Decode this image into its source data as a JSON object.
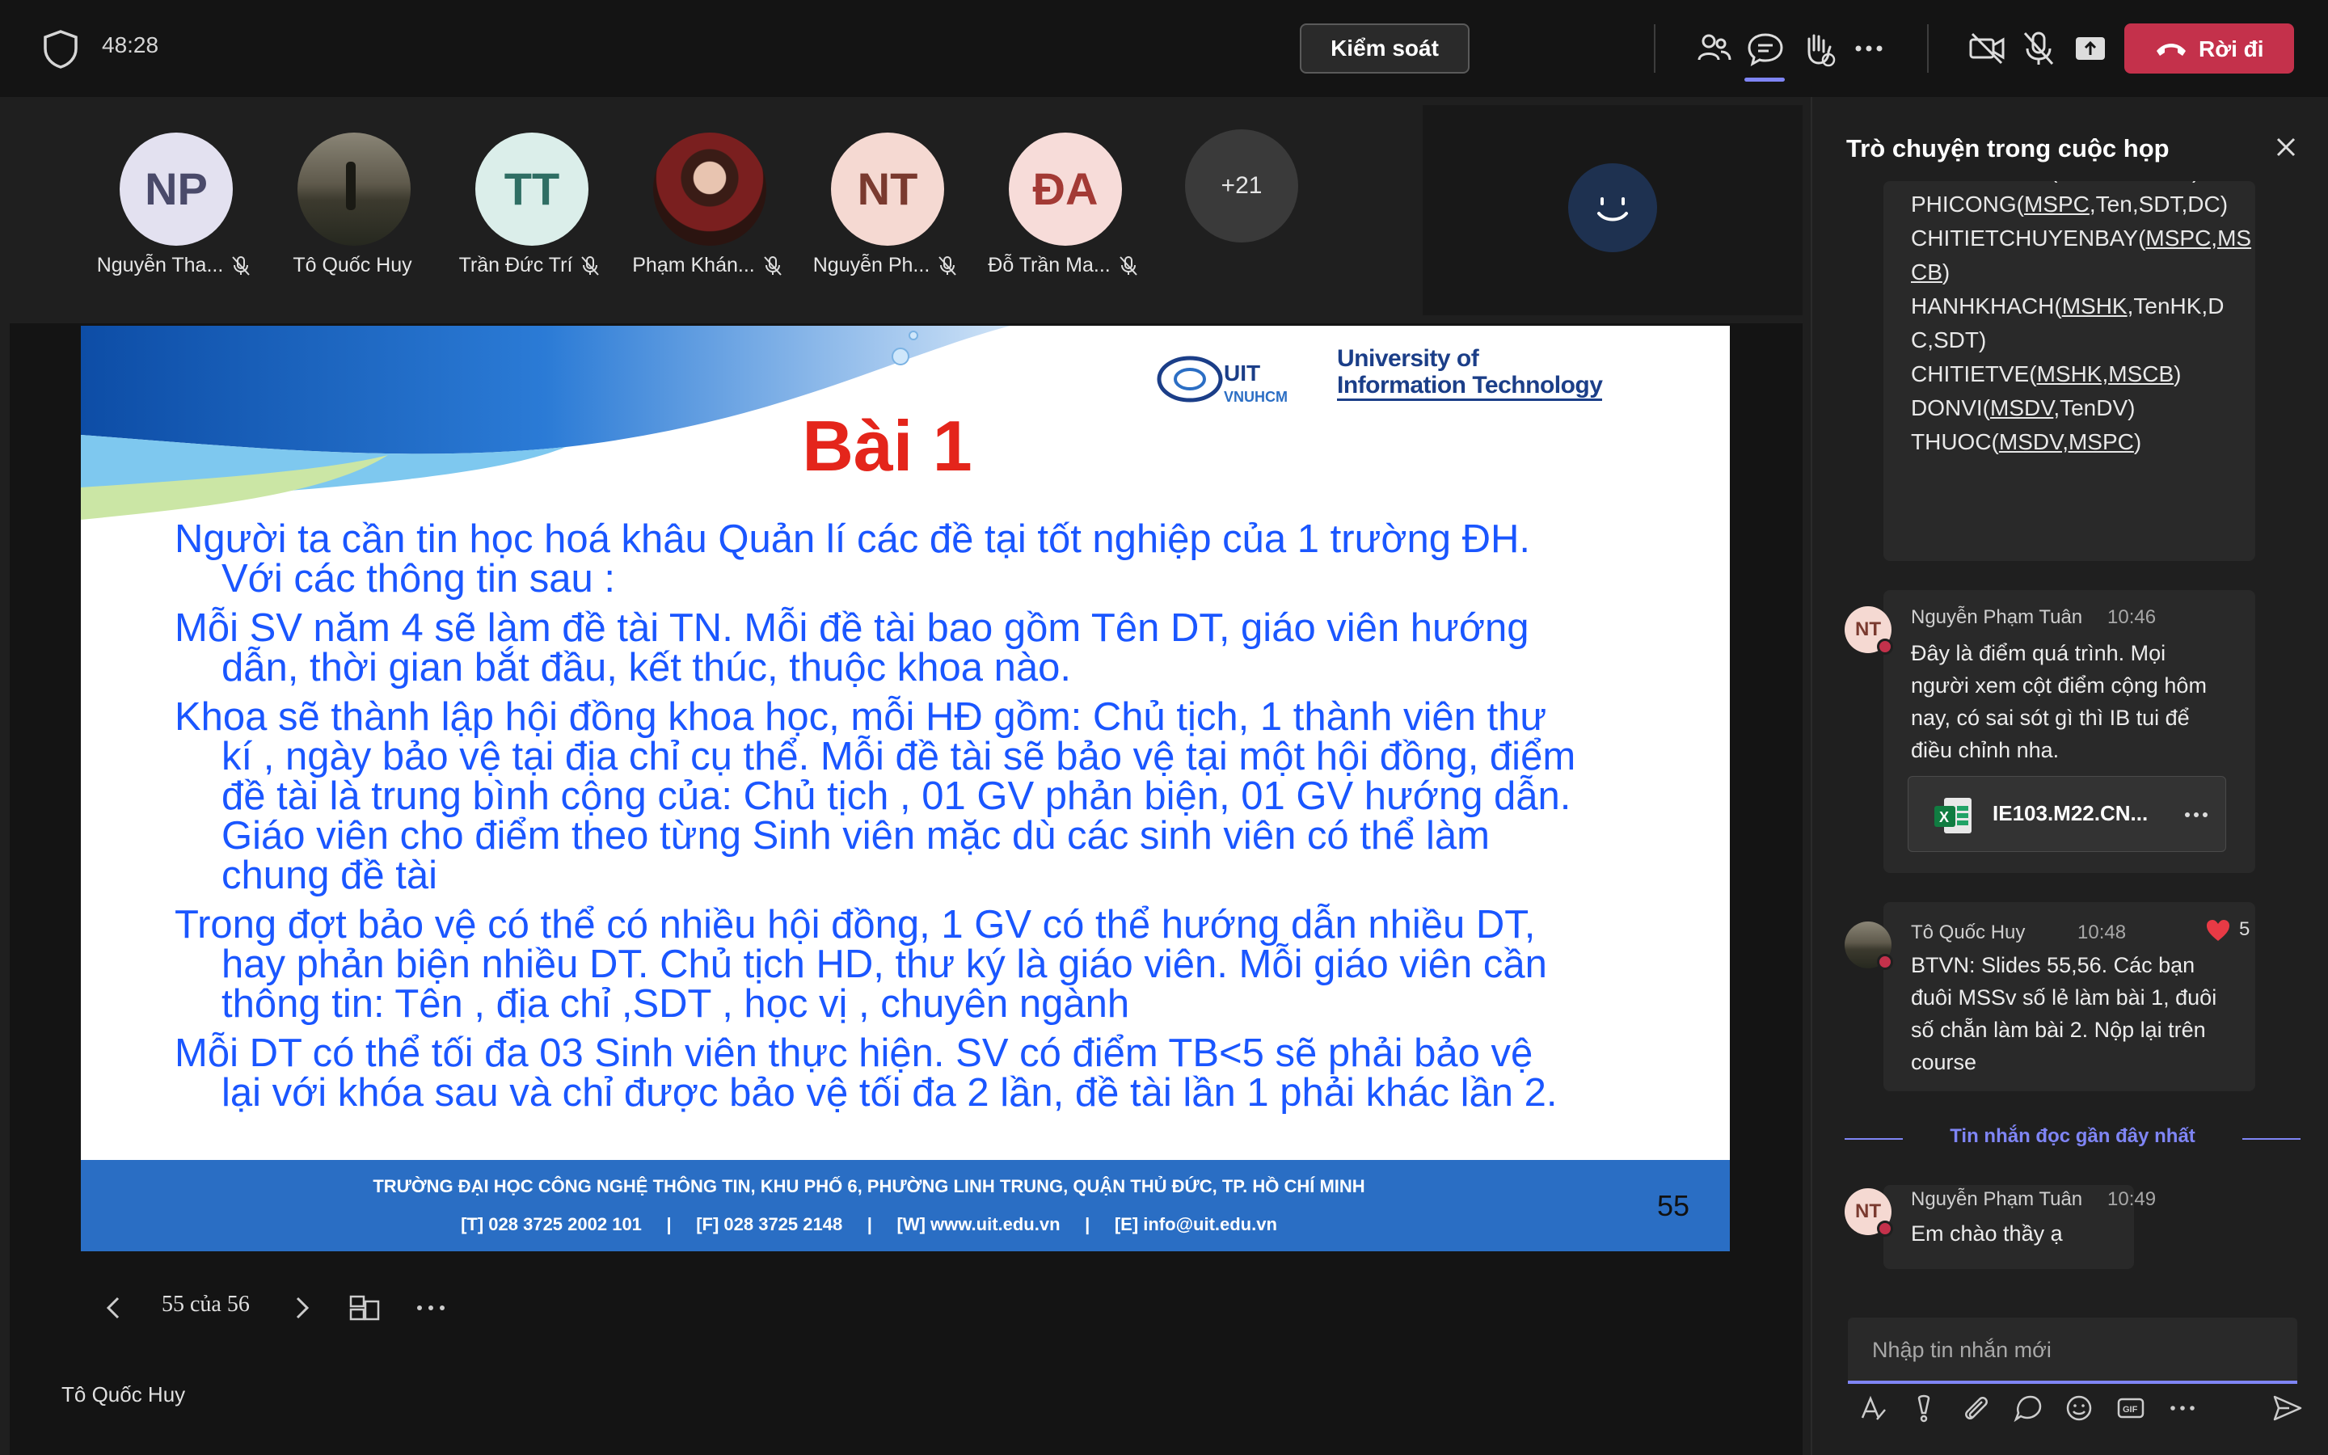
{
  "topbar": {
    "timer": "48:28",
    "control_label": "Kiểm soát",
    "leave_label": "Rời đi"
  },
  "participants": [
    {
      "initials": "NP",
      "name": "Nguyễn Tha...",
      "bg": "#e3e1f0",
      "fg": "#4a4a6a",
      "muted": true
    },
    {
      "initials": "",
      "name": "Tô Quốc Huy",
      "photo": true,
      "muted": false
    },
    {
      "initials": "TT",
      "name": "Trần Đức Trí",
      "bg": "#dbeeea",
      "fg": "#2f6e64",
      "muted": true
    },
    {
      "initials": "",
      "name": "Phạm Khán...",
      "photo": true,
      "muted": true
    },
    {
      "initials": "NT",
      "name": "Nguyễn Ph...",
      "bg": "#f5d9d2",
      "fg": "#7a3a2f",
      "muted": true
    },
    {
      "initials": "ĐA",
      "name": "Đỗ Trần Ma...",
      "bg": "#f7dcd9",
      "fg": "#a33a35",
      "muted": true
    }
  ],
  "more_participants": "+21",
  "slide": {
    "title": "Bài 1",
    "university_line1": "University of",
    "university_line2": "Information Technology",
    "logo_text": "UIT",
    "logo_sub": "VNUHCM",
    "paragraphs": [
      {
        "first": "Người ta cần tin học hoá khâu Quản lí các đề tại tốt nghiệp của 1 trường ĐH.",
        "cont": [
          "Với các thông tin sau :"
        ]
      },
      {
        "first": "Mỗi SV năm 4 sẽ làm đề tài TN. Mỗi đề tài bao gồm Tên DT, giáo viên hướng",
        "cont": [
          "dẫn, thời gian bắt đầu, kết thúc, thuộc khoa nào."
        ]
      },
      {
        "first": "Khoa sẽ thành lập hội đồng khoa học, mỗi HĐ gồm: Chủ tịch, 1 thành viên thư",
        "cont": [
          "kí , ngày bảo vệ tại địa chỉ cụ thể. Mỗi đề tài sẽ bảo vệ tại một hội đồng, điểm",
          "đề tài là trung bình cộng của: Chủ tịch , 01 GV phản biện, 01 GV hướng dẫn.",
          "Giáo viên cho điểm theo từng Sinh viên mặc dù các sinh viên có thể làm",
          "chung đề tài"
        ]
      },
      {
        "first": "Trong đợt bảo vệ có thể có nhiều hội đồng, 1 GV có thể hướng dẫn nhiều DT,",
        "cont": [
          "hay phản biện nhiều DT. Chủ tịch HD, thư ký là giáo viên. Mỗi giáo viên cần",
          "thông tin: Tên , địa chỉ ,SDT , học vị , chuyên ngành"
        ]
      },
      {
        "first": "Mỗi DT có thể tối đa 03 Sinh viên thực hiện. SV có điểm TB<5 sẽ phải bảo vệ",
        "cont": [
          "lại với khóa sau và chỉ được bảo vệ tối đa 2 lần, đề tài lần 1 phải khác lần 2."
        ]
      }
    ],
    "footer_line1": "TRƯỜNG ĐẠI HỌC CÔNG NGHỆ THÔNG TIN, KHU PHỐ 6, PHƯỜNG LINH TRUNG, QUẬN THỦ ĐỨC, TP. HỒ CHÍ MINH",
    "footer_line2": "[T] 028 3725 2002 101     |     [F] 028 3725 2148     |     [W] www.uit.edu.vn     |     [E] info@uit.edu.vn",
    "page_number": "55"
  },
  "slide_nav": {
    "counter": "55 của 56"
  },
  "presenter_name": "Tô Quốc Huy",
  "chat": {
    "title": "Trò chuyện trong cuộc họp",
    "code_lines": [
      {
        "pre": "CHUYENBAY(",
        "u": "MSTB,MSCB",
        "post": ")"
      },
      {
        "pre": "PHICONG(",
        "u": "MSPC",
        "post": ",Ten,SDT,DC)"
      },
      {
        "pre": "CHITIETCHUYENBAY(",
        "u": "MSPC,MS",
        "post": ""
      },
      {
        "pre": "",
        "u": "CB",
        "post": ")"
      },
      {
        "pre": "HANHKHACH(",
        "u": "MSHK",
        "post": ",TenHK,D"
      },
      {
        "pre": "C,SDT)",
        "u": "",
        "post": ""
      },
      {
        "pre": "CHITIETVE(",
        "u": "MSHK,MSCB",
        "post": ")"
      },
      {
        "pre": "DONVI(",
        "u": "MSDV",
        "post": ",TenDV)"
      },
      {
        "pre": "THUOC(",
        "u": "MSDV,MSPC",
        "post": ")"
      }
    ],
    "messages": [
      {
        "author": "Nguyễn Phạm Tuân",
        "time": "10:46",
        "initials": "NT",
        "lines": [
          "Đây là điểm quá trình. Mọi",
          "người xem cột điểm cộng hôm",
          "nay, có sai sót gì thì IB tui để",
          "điều chỉnh nha."
        ],
        "file": "IE103.M22.CN..."
      },
      {
        "author": "Tô Quốc Huy",
        "time": "10:48",
        "reactions": "5",
        "lines": [
          "BTVN: Slides 55,56. Các bạn",
          "đuôi MSSv số lẻ làm bài 1, đuôi",
          "số chẵn làm bài 2. Nộp lại trên",
          "course"
        ]
      },
      {
        "author": "Nguyễn Phạm Tuân",
        "time": "10:49",
        "initials": "NT",
        "lines": [
          "Em chào thầy ạ"
        ]
      }
    ],
    "recent_label": "Tin nhắn đọc gần đây nhất",
    "compose_placeholder": "Nhập tin nhắn mới"
  }
}
